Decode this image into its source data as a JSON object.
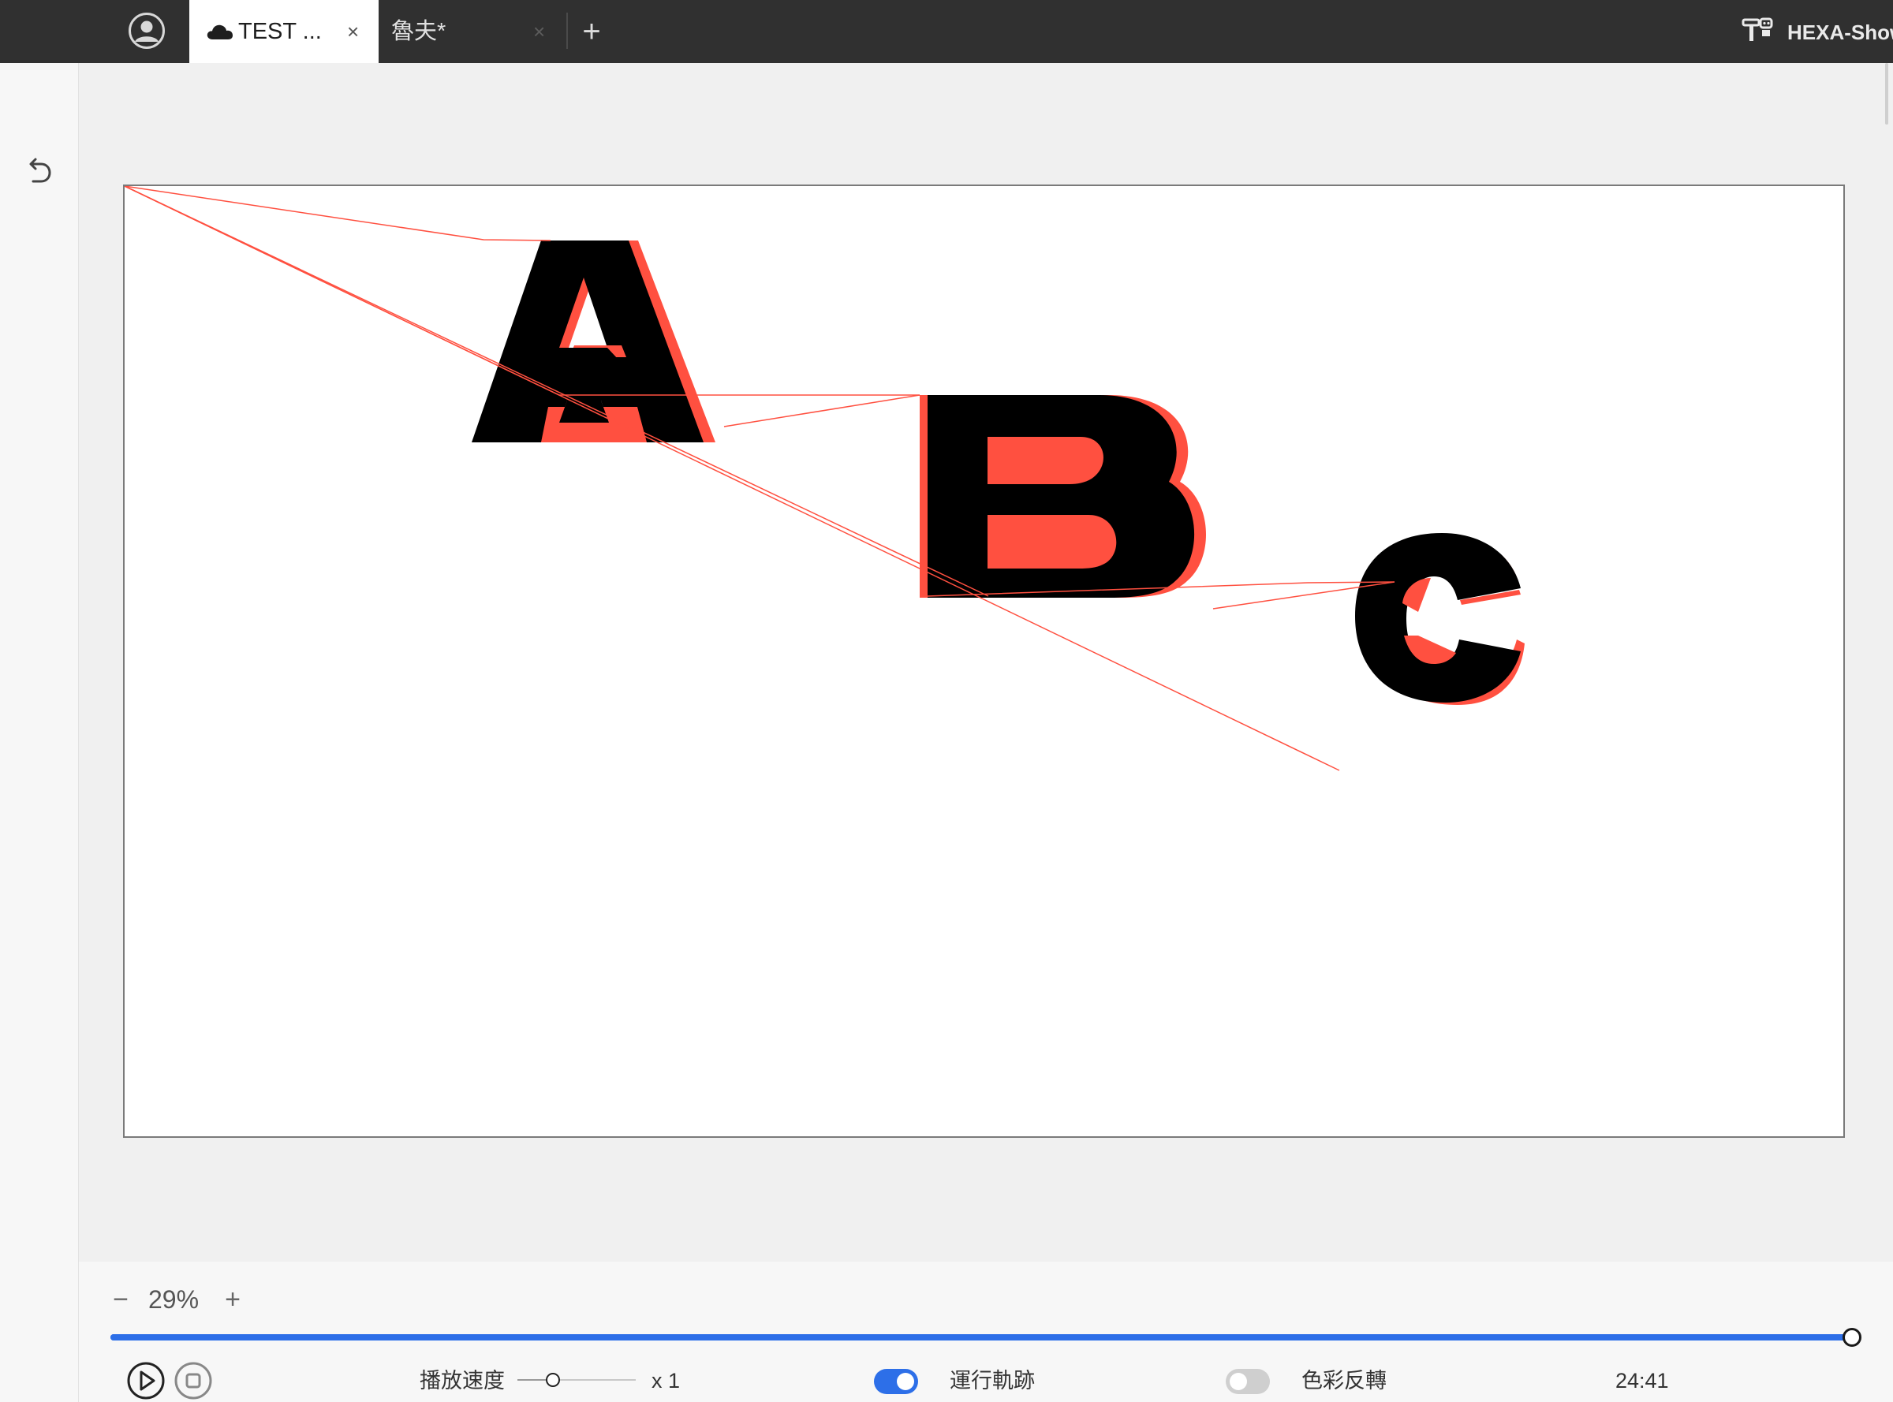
{
  "header": {
    "tabs": [
      {
        "label": "TEST ...",
        "close": "×",
        "cloud": true,
        "active": true
      },
      {
        "label": "魯夫*",
        "close": "×",
        "cloud": false,
        "active": false
      }
    ],
    "new_tab": "+",
    "brand": "HEXA-Show",
    "icons": {
      "avatar": "user-avatar-icon",
      "cloud": "cloud-icon",
      "brand": "robot-icon"
    }
  },
  "left_toolbar": {
    "undo_icon": "undo-icon"
  },
  "canvas": {
    "letters": [
      "A",
      "B",
      "C"
    ],
    "colors": {
      "fill": "#000000",
      "outline": "#ff5040",
      "path": "#ff5040",
      "background": "#ffffff"
    }
  },
  "bottom": {
    "zoom": {
      "minus": "−",
      "value": "29%",
      "plus": "+"
    },
    "progress_fraction": 1.0,
    "play_icon": "play-icon",
    "stop_icon": "stop-icon",
    "speed_label": "播放速度",
    "speed_value": "x 1",
    "speed_fraction": 0.3,
    "track_label": "運行軌跡",
    "track_on": true,
    "invert_label": "色彩反轉",
    "invert_on": false,
    "time": "24:41"
  },
  "accent_color": "#2d6fe8"
}
